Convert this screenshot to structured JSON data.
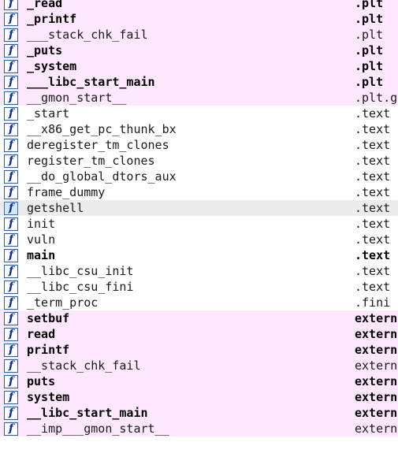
{
  "functions": [
    {
      "name": "_read",
      "segment": ".plt",
      "bold": true,
      "bg": "pink"
    },
    {
      "name": "_printf",
      "segment": ".plt",
      "bold": true,
      "bg": "pink"
    },
    {
      "name": "___stack_chk_fail",
      "segment": ".plt",
      "bold": false,
      "bg": "pink"
    },
    {
      "name": "_puts",
      "segment": ".plt",
      "bold": true,
      "bg": "pink"
    },
    {
      "name": "_system",
      "segment": ".plt",
      "bold": true,
      "bg": "pink"
    },
    {
      "name": "___libc_start_main",
      "segment": ".plt",
      "bold": true,
      "bg": "pink"
    },
    {
      "name": "__gmon_start__",
      "segment": ".plt.g",
      "bold": false,
      "bg": "pink"
    },
    {
      "name": "_start",
      "segment": ".text",
      "bold": false,
      "bg": "white"
    },
    {
      "name": "__x86_get_pc_thunk_bx",
      "segment": ".text",
      "bold": false,
      "bg": "white"
    },
    {
      "name": "deregister_tm_clones",
      "segment": ".text",
      "bold": false,
      "bg": "white"
    },
    {
      "name": "register_tm_clones",
      "segment": ".text",
      "bold": false,
      "bg": "white"
    },
    {
      "name": "__do_global_dtors_aux",
      "segment": ".text",
      "bold": false,
      "bg": "white"
    },
    {
      "name": "frame_dummy",
      "segment": ".text",
      "bold": false,
      "bg": "white"
    },
    {
      "name": "getshell",
      "segment": ".text",
      "bold": false,
      "bg": "selected"
    },
    {
      "name": "init",
      "segment": ".text",
      "bold": false,
      "bg": "white"
    },
    {
      "name": "vuln",
      "segment": ".text",
      "bold": false,
      "bg": "white"
    },
    {
      "name": "main",
      "segment": ".text",
      "bold": true,
      "bg": "white"
    },
    {
      "name": "__libc_csu_init",
      "segment": ".text",
      "bold": false,
      "bg": "white"
    },
    {
      "name": "__libc_csu_fini",
      "segment": ".text",
      "bold": false,
      "bg": "white"
    },
    {
      "name": "_term_proc",
      "segment": ".fini",
      "bold": false,
      "bg": "white"
    },
    {
      "name": "setbuf",
      "segment": "extern",
      "bold": true,
      "bg": "pink"
    },
    {
      "name": "read",
      "segment": "extern",
      "bold": true,
      "bg": "pink"
    },
    {
      "name": "printf",
      "segment": "extern",
      "bold": true,
      "bg": "pink"
    },
    {
      "name": "__stack_chk_fail",
      "segment": "extern",
      "bold": false,
      "bg": "pink"
    },
    {
      "name": "puts",
      "segment": "extern",
      "bold": true,
      "bg": "pink"
    },
    {
      "name": "system",
      "segment": "extern",
      "bold": true,
      "bg": "pink"
    },
    {
      "name": "__libc_start_main",
      "segment": "extern",
      "bold": true,
      "bg": "pink"
    },
    {
      "name": "__imp___gmon_start__",
      "segment": "extern",
      "bold": false,
      "bg": "pink"
    }
  ],
  "icon": {
    "glyph": "f",
    "name": "function-icon",
    "border_color": "#2f5f9e",
    "glyph_color": "#0b2f80"
  },
  "colors": {
    "pink_row": "#fde8fd",
    "selected_row": "#ececec",
    "white_row": "#ffffff"
  }
}
